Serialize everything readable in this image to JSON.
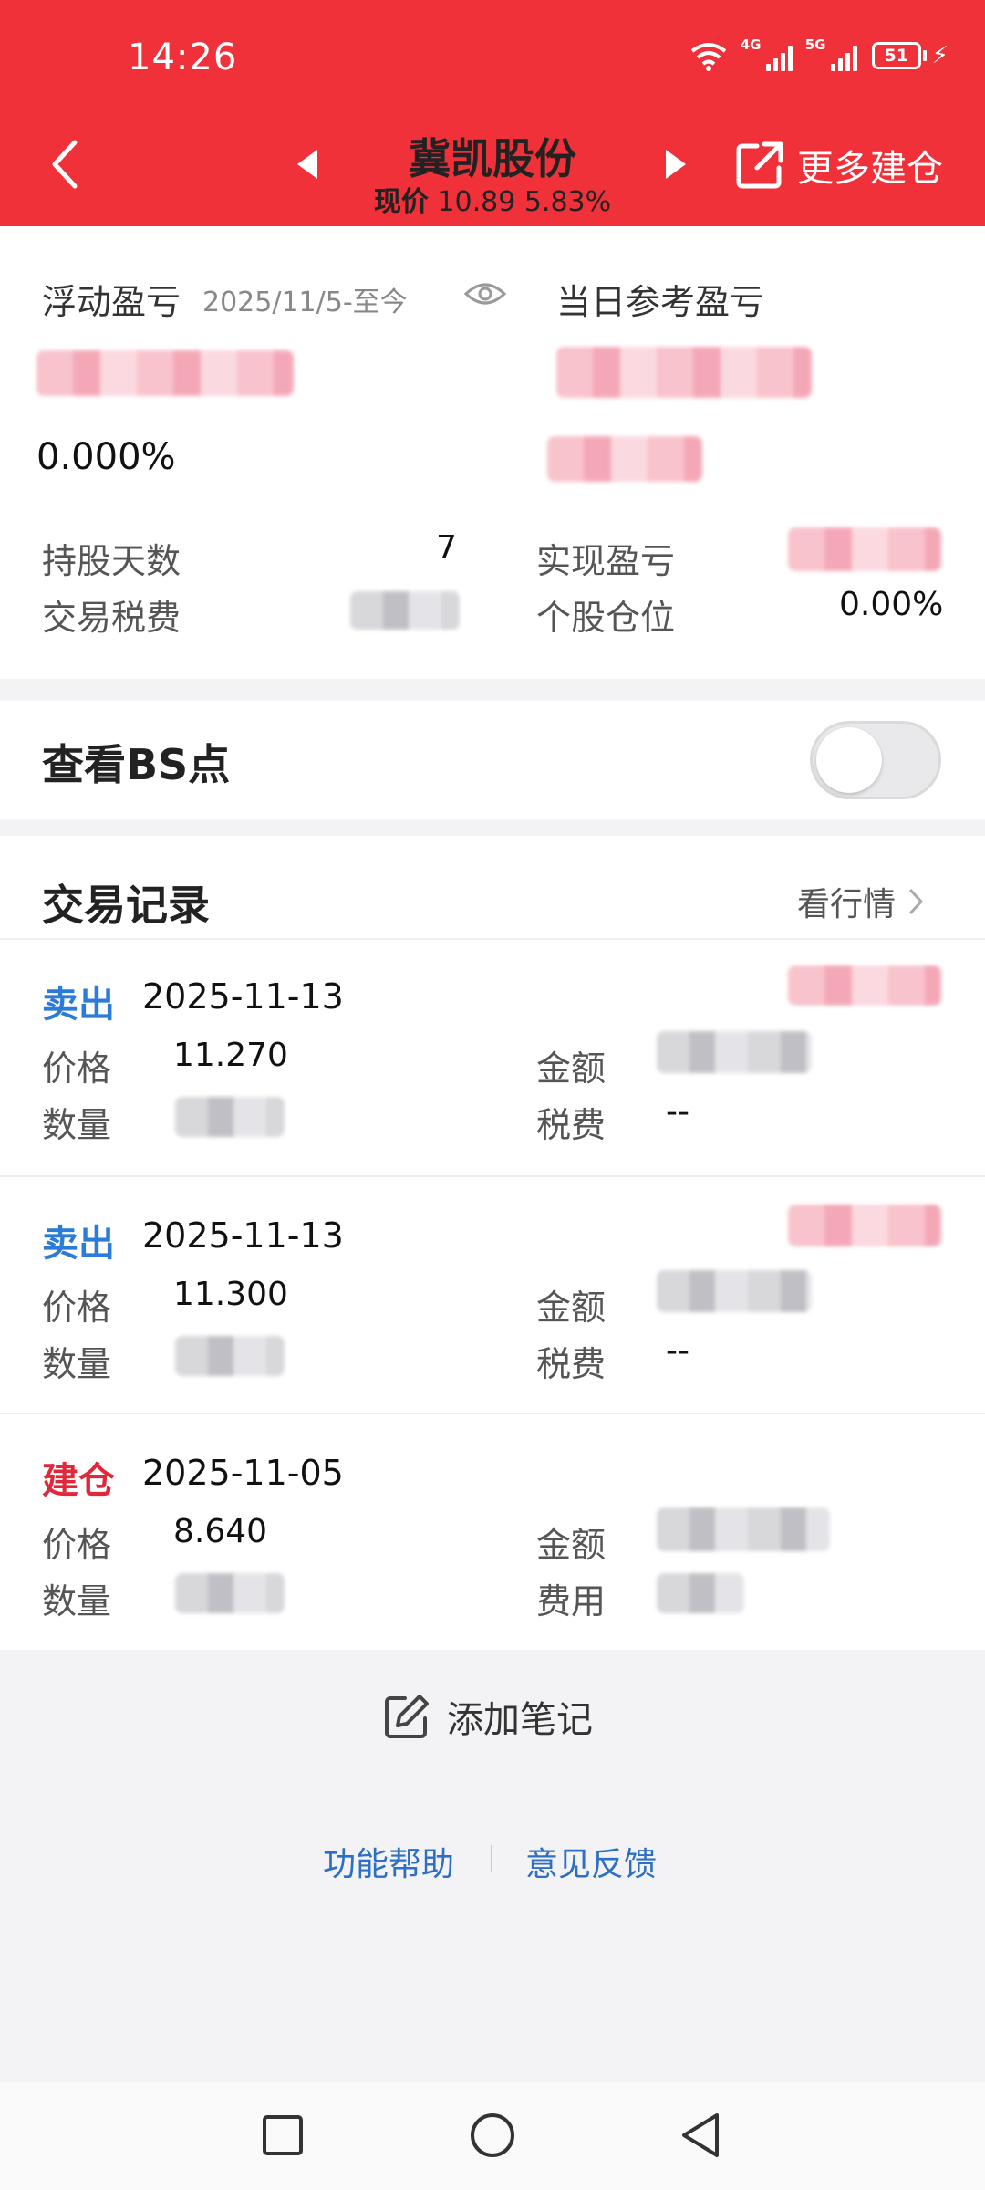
{
  "status_bar": {
    "time": "14:26",
    "net1": "4G",
    "net2": "5G",
    "battery": "51"
  },
  "header": {
    "title": "冀凯股份",
    "price_label": "现价",
    "price": "10.89",
    "change": "5.83%",
    "more_build_label": "更多建仓"
  },
  "pnl": {
    "floating_label": "浮动盈亏",
    "date_range": "2025/11/5-至今",
    "floating_pct": "0.000%",
    "daily_label": "当日参考盈亏",
    "holding_days_label": "持股天数",
    "holding_days": "7",
    "tax_label": "交易税费",
    "realized_label": "实现盈亏",
    "position_label": "个股仓位",
    "position_value": "0.00%"
  },
  "bs": {
    "label": "查看BS点"
  },
  "records": {
    "title": "交易记录",
    "market_link": "看行情",
    "items": [
      {
        "type": "卖出",
        "date": "2025-11-13",
        "price_label": "价格",
        "price": "11.270",
        "amount_label": "金额",
        "qty_label": "数量",
        "fee_label": "税费",
        "fee": "--"
      },
      {
        "type": "卖出",
        "date": "2025-11-13",
        "price_label": "价格",
        "price": "11.300",
        "amount_label": "金额",
        "qty_label": "数量",
        "fee_label": "税费",
        "fee": "--"
      },
      {
        "type": "建仓",
        "date": "2025-11-05",
        "price_label": "价格",
        "price": "8.640",
        "amount_label": "金额",
        "qty_label": "数量",
        "fee_label": "费用",
        "fee": ""
      }
    ]
  },
  "footer": {
    "add_note": "添加笔记",
    "help": "功能帮助",
    "feedback": "意见反馈"
  },
  "colors": {
    "header_red": "#f1313a",
    "sell_blue": "#2b7bd8",
    "build_red": "#e0283a",
    "link_blue": "#2d6fc4"
  },
  "icons": [
    "back-arrow-icon",
    "triangle-left-icon",
    "triangle-right-icon",
    "external-link-icon",
    "eye-icon",
    "chevron-right-icon",
    "edit-icon",
    "square-nav-icon",
    "circle-nav-icon",
    "triangle-back-nav-icon",
    "wifi-icon",
    "signal-icon",
    "battery-icon",
    "charging-icon"
  ]
}
